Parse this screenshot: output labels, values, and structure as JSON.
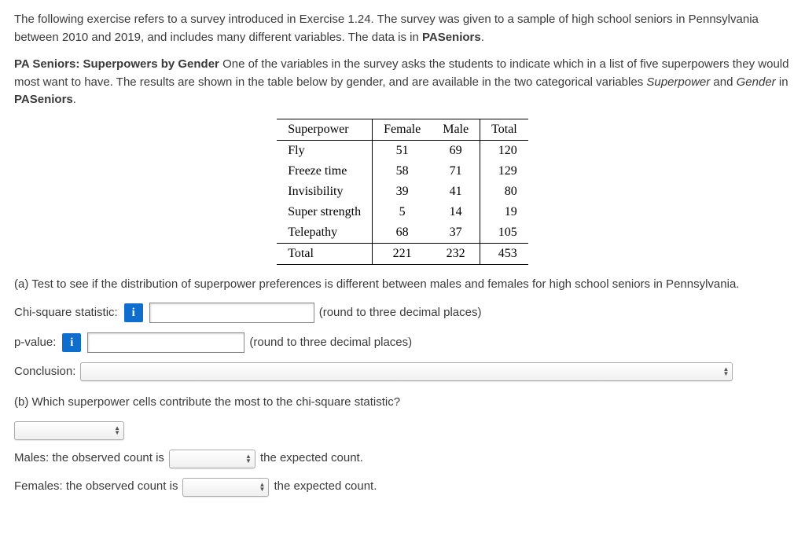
{
  "intro": {
    "text_a": "The following exercise refers to a survey introduced in Exercise 1.24. The survey was given to a sample of high school seniors in Pennsylvania between 2010 and 2019, and includes many different variables. The data is in ",
    "dataset": "PASeniors",
    "text_b": "."
  },
  "desc": {
    "title": "PA Seniors: Superpowers by Gender",
    "text_a": " One of the variables in the survey asks the students to indicate which in a list of five superpowers they would most want to have. The results are shown in the table below by gender, and are available in the two categorical variables ",
    "var1": "Superpower",
    "and": " and ",
    "var2": "Gender",
    "text_b": " in ",
    "dataset": "PASeniors",
    "text_c": "."
  },
  "table": {
    "headers": {
      "c0": "Superpower",
      "c1": "Female",
      "c2": "Male",
      "c3": "Total"
    },
    "rows": [
      {
        "c0": "Fly",
        "c1": "51",
        "c2": "69",
        "c3": "120"
      },
      {
        "c0": "Freeze time",
        "c1": "58",
        "c2": "71",
        "c3": "129"
      },
      {
        "c0": "Invisibility",
        "c1": "39",
        "c2": "41",
        "c3": "80"
      },
      {
        "c0": "Super strength",
        "c1": "5",
        "c2": "14",
        "c3": "19"
      },
      {
        "c0": "Telepathy",
        "c1": "68",
        "c2": "37",
        "c3": "105"
      }
    ],
    "total": {
      "c0": "Total",
      "c1": "221",
      "c2": "232",
      "c3": "453"
    }
  },
  "partA": {
    "prompt": "(a) Test to see if the distribution of superpower preferences is different between males and females for high school seniors in Pennsylvania.",
    "chi_label": "Chi-square statistic:",
    "chi_hint": "(round to three decimal places)",
    "p_label": "p-value:",
    "p_hint": "(round to three decimal places)",
    "conclusion_label": "Conclusion:"
  },
  "partB": {
    "prompt": "(b) Which superpower cells contribute the most to the chi-square statistic?",
    "males_label": "Males: the observed count is",
    "females_label": "Females: the observed count is",
    "suffix": "the expected count."
  },
  "icons": {
    "info": "i"
  }
}
